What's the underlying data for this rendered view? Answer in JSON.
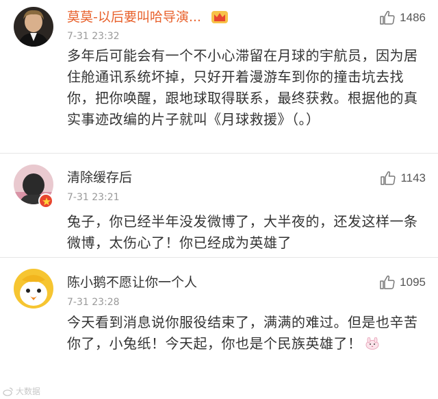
{
  "comments": [
    {
      "username": "莫莫-以后要叫哈导演...",
      "time": "7-31 23:32",
      "likes": "1486",
      "text": "多年后可能会有一个不小心滞留在月球的宇航员，因为居住舱通讯系统坏掉，只好开着漫游车到你的撞击坑去找你，把你唤醒，跟地球取得联系，最终获救。根据他的真实事迹改编的片子就叫《月球救援》（。）",
      "username_color": "#e8612c",
      "has_vip_icon": true
    },
    {
      "username": "清除缓存后",
      "time": "7-31 23:21",
      "likes": "1143",
      "text": "兔子，你已经半年没发微博了，大半夜的，还发这样一条微博，太伤心了！你已经成为英雄了",
      "has_badge": true
    },
    {
      "username": "陈小鹅不愿让你一个人",
      "time": "7-31 23:28",
      "likes": "1095",
      "text": "今天看到消息说你服役结束了，满满的难过。但是也辛苦你了，小兔纸！今天起，你也是个民族英雄了！",
      "has_emoji": true
    }
  ],
  "watermark": {
    "text": "大数据"
  },
  "colors": {
    "accent": "#e8612c",
    "text": "#333333",
    "meta": "#999999",
    "divider": "#e6e6e6"
  },
  "icons": [
    "thumbs-up-icon",
    "vip-crown-icon",
    "verified-badge-icon",
    "rabbit-emoji-icon",
    "weibo-logo-icon"
  ]
}
